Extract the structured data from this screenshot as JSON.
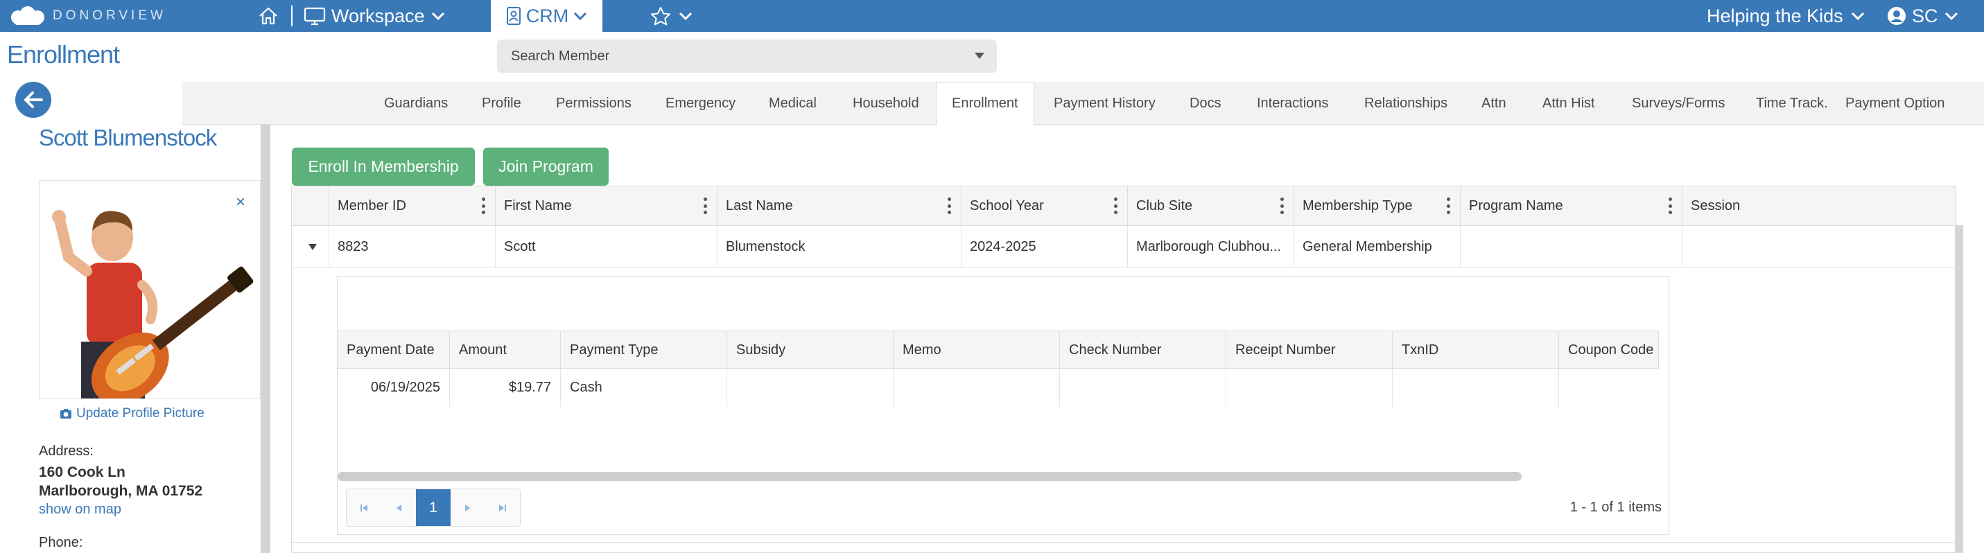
{
  "topbar": {
    "brand": "DONORVIEW",
    "workspace_label": "Workspace",
    "crm_label": "CRM",
    "org_label": "Helping the Kids",
    "user_initials": "SC",
    "bg_color": "#3a79b8"
  },
  "header": {
    "page_title": "Enrollment",
    "search_placeholder": "Search Member"
  },
  "tabs": [
    {
      "label": "Guardians"
    },
    {
      "label": "Profile"
    },
    {
      "label": "Permissions"
    },
    {
      "label": "Emergency"
    },
    {
      "label": "Medical"
    },
    {
      "label": "Household"
    },
    {
      "label": "Enrollment",
      "active": true
    },
    {
      "label": "Payment History"
    },
    {
      "label": "Docs"
    },
    {
      "label": "Interactions"
    },
    {
      "label": "Relationships"
    },
    {
      "label": "Attn"
    },
    {
      "label": "Attn Hist"
    },
    {
      "label": "Surveys/Forms"
    },
    {
      "label": "Time Track."
    },
    {
      "label": "Payment Option"
    }
  ],
  "member": {
    "name": "Scott Blumenstock",
    "update_picture_label": "Update Profile Picture",
    "close_label": "×",
    "address_label": "Address:",
    "address_line1": "160 Cook Ln",
    "address_line2": "Marlborough, MA 01752",
    "map_link": "show on map",
    "phone_label": "Phone:"
  },
  "actions": {
    "enroll_label": "Enroll In Membership",
    "join_label": "Join Program",
    "accent_color": "#5cb27a"
  },
  "grid": {
    "columns": [
      "Member ID",
      "First Name",
      "Last Name",
      "School Year",
      "Club Site",
      "Membership Type",
      "Program Name",
      "Session"
    ],
    "row": {
      "member_id": "8823",
      "first_name": "Scott",
      "last_name": "Blumenstock",
      "school_year": "2024-2025",
      "club_site": "Marlborough Clubhou...",
      "membership_type": "General Membership",
      "program_name": "",
      "session": ""
    }
  },
  "payments": {
    "columns": [
      "Payment Date",
      "Amount",
      "Payment Type",
      "Subsidy",
      "Memo",
      "Check Number",
      "Receipt Number",
      "TxnID",
      "Coupon Code"
    ],
    "rows": [
      {
        "payment_date": "06/19/2025",
        "amount": "$19.77",
        "payment_type": "Cash",
        "subsidy": "",
        "memo": "",
        "check_number": "",
        "receipt_number": "",
        "txn_id": "",
        "coupon_code": ""
      }
    ],
    "current_page": "1",
    "pager_info": "1 - 1 of 1 items"
  }
}
